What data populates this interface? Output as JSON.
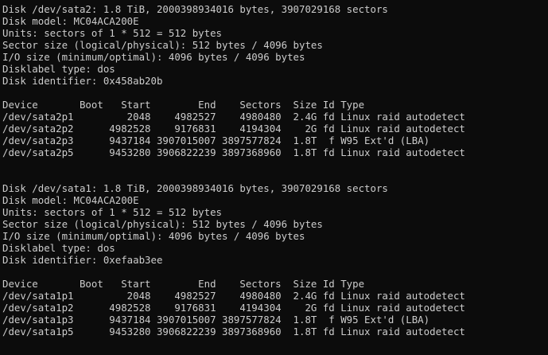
{
  "colors": {
    "background": "#0c0c0c",
    "foreground": "#cccccc"
  },
  "disks": [
    {
      "header": "Disk /dev/sata2: 1.8 TiB, 2000398934016 bytes, 3907029168 sectors",
      "model": "Disk model: MC04ACA200E",
      "units": "Units: sectors of 1 * 512 = 512 bytes",
      "sector_size": "Sector size (logical/physical): 512 bytes / 4096 bytes",
      "io_size": "I/O size (minimum/optimal): 4096 bytes / 4096 bytes",
      "label_type": "Disklabel type: dos",
      "identifier": "Disk identifier: 0x458ab20b",
      "table_header": "Device       Boot   Start        End    Sectors  Size Id Type",
      "partitions": [
        "/dev/sata2p1         2048    4982527    4980480  2.4G fd Linux raid autodetect",
        "/dev/sata2p2      4982528    9176831    4194304    2G fd Linux raid autodetect",
        "/dev/sata2p3      9437184 3907015007 3897577824  1.8T  f W95 Ext'd (LBA)",
        "/dev/sata2p5      9453280 3906822239 3897368960  1.8T fd Linux raid autodetect"
      ]
    },
    {
      "header": "Disk /dev/sata1: 1.8 TiB, 2000398934016 bytes, 3907029168 sectors",
      "model": "Disk model: MC04ACA200E",
      "units": "Units: sectors of 1 * 512 = 512 bytes",
      "sector_size": "Sector size (logical/physical): 512 bytes / 4096 bytes",
      "io_size": "I/O size (minimum/optimal): 4096 bytes / 4096 bytes",
      "label_type": "Disklabel type: dos",
      "identifier": "Disk identifier: 0xefaab3ee",
      "table_header": "Device       Boot   Start        End    Sectors  Size Id Type",
      "partitions": [
        "/dev/sata1p1         2048    4982527    4980480  2.4G fd Linux raid autodetect",
        "/dev/sata1p2      4982528    9176831    4194304    2G fd Linux raid autodetect",
        "/dev/sata1p3      9437184 3907015007 3897577824  1.8T  f W95 Ext'd (LBA)",
        "/dev/sata1p5      9453280 3906822239 3897368960  1.8T fd Linux raid autodetect"
      ]
    }
  ]
}
